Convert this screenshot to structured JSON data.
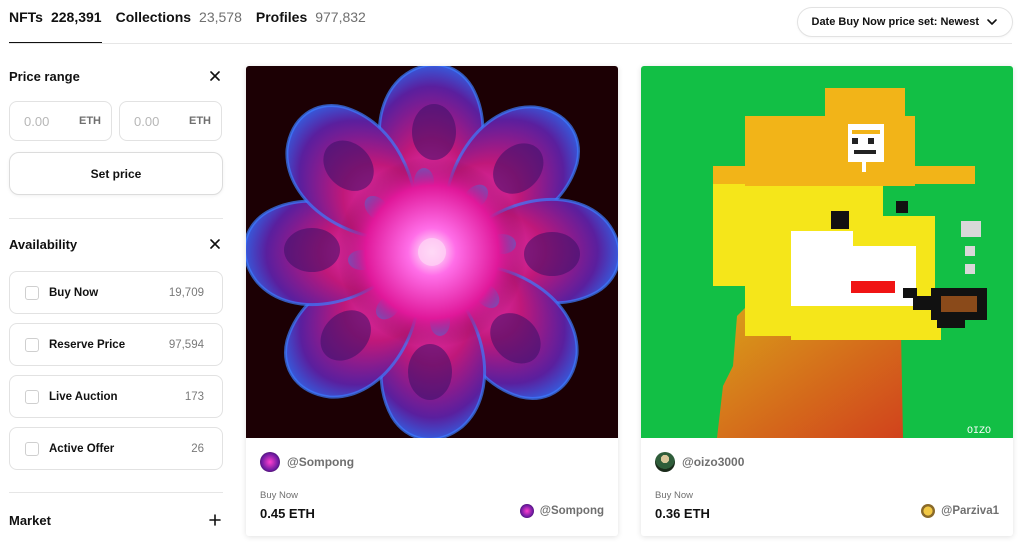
{
  "tabs": [
    {
      "label": "NFTs",
      "count": "228,391"
    },
    {
      "label": "Collections",
      "count": "23,578"
    },
    {
      "label": "Profiles",
      "count": "977,832"
    }
  ],
  "sort": {
    "label": "Date Buy Now price set: Newest",
    "icon": "chevron-down-icon"
  },
  "sidebar": {
    "price": {
      "title": "Price range",
      "min_placeholder": "0.00",
      "max_placeholder": "0.00",
      "unit": "ETH",
      "set_button": "Set price"
    },
    "availability": {
      "title": "Availability",
      "items": [
        {
          "label": "Buy Now",
          "count": "19,709"
        },
        {
          "label": "Reserve Price",
          "count": "97,594"
        },
        {
          "label": "Live Auction",
          "count": "173"
        },
        {
          "label": "Active Offer",
          "count": "26"
        }
      ]
    },
    "market": {
      "title": "Market"
    }
  },
  "cards": [
    {
      "creator": "@Sompong",
      "status": "Buy Now",
      "price": "0.45 ETH",
      "owner": "@Sompong"
    },
    {
      "creator": "@oizo3000",
      "status": "Buy Now",
      "price": "0.36 ETH",
      "owner": "@Parziva1",
      "signature": "OIZO"
    }
  ],
  "colors": {
    "accent": "#111111",
    "muted": "#6f6f6f",
    "border": "#e2e2e2",
    "art1_bg": "#1c0004",
    "art2_bg": "#12bf45"
  }
}
